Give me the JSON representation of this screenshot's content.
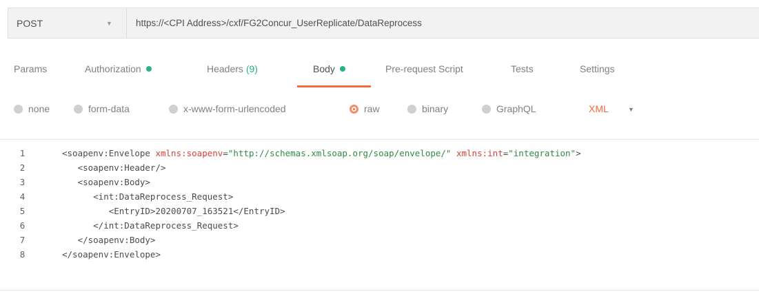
{
  "request": {
    "method": "POST",
    "url": "https://<CPI Address>/cxf/FG2Concur_UserReplicate/DataReprocess"
  },
  "tabs": [
    {
      "label": "Params",
      "suffix": "",
      "dot": false,
      "active": false
    },
    {
      "label": "Authorization",
      "suffix": "",
      "dot": true,
      "active": false
    },
    {
      "label": "Headers",
      "suffix": "(9)",
      "dot": false,
      "active": false
    },
    {
      "label": "Body",
      "suffix": "",
      "dot": true,
      "active": true
    },
    {
      "label": "Pre-request Script",
      "suffix": "",
      "dot": false,
      "active": false
    },
    {
      "label": "Tests",
      "suffix": "",
      "dot": false,
      "active": false
    },
    {
      "label": "Settings",
      "suffix": "",
      "dot": false,
      "active": false
    }
  ],
  "body_types": [
    {
      "label": "none",
      "selected": false
    },
    {
      "label": "form-data",
      "selected": false
    },
    {
      "label": "x-www-form-urlencoded",
      "selected": false
    },
    {
      "label": "raw",
      "selected": true
    },
    {
      "label": "binary",
      "selected": false
    },
    {
      "label": "GraphQL",
      "selected": false
    }
  ],
  "language": "XML",
  "editor": {
    "lines": [
      {
        "num": "1",
        "parts": [
          [
            "tag",
            "<soapenv:Envelope "
          ],
          [
            "attr",
            "xmlns:soapenv"
          ],
          [
            "tag",
            "="
          ],
          [
            "val",
            "\"http://schemas.xmlsoap.org/soap/envelope/\""
          ],
          [
            "tag",
            " "
          ],
          [
            "attr",
            "xmlns:int"
          ],
          [
            "tag",
            "="
          ],
          [
            "val",
            "\"integration\""
          ],
          [
            "tag",
            ">"
          ]
        ]
      },
      {
        "num": "2",
        "parts": [
          [
            "tag",
            "   <soapenv:Header/>"
          ]
        ]
      },
      {
        "num": "3",
        "parts": [
          [
            "tag",
            "   <soapenv:Body>"
          ]
        ]
      },
      {
        "num": "4",
        "parts": [
          [
            "tag",
            "      <int:DataReprocess_Request>"
          ]
        ]
      },
      {
        "num": "5",
        "parts": [
          [
            "tag",
            "         <EntryID>"
          ],
          [
            "txt",
            "20200707_163521"
          ],
          [
            "tag",
            "</EntryID>"
          ]
        ]
      },
      {
        "num": "6",
        "parts": [
          [
            "tag",
            "      </int:DataReprocess_Request>"
          ]
        ]
      },
      {
        "num": "7",
        "parts": [
          [
            "tag",
            "   </soapenv:Body>"
          ]
        ]
      },
      {
        "num": "8",
        "parts": [
          [
            "tag",
            "</soapenv:Envelope>"
          ]
        ]
      }
    ]
  },
  "colors": {
    "accent": "#f26b3a",
    "status_dot": "#26b47f"
  }
}
